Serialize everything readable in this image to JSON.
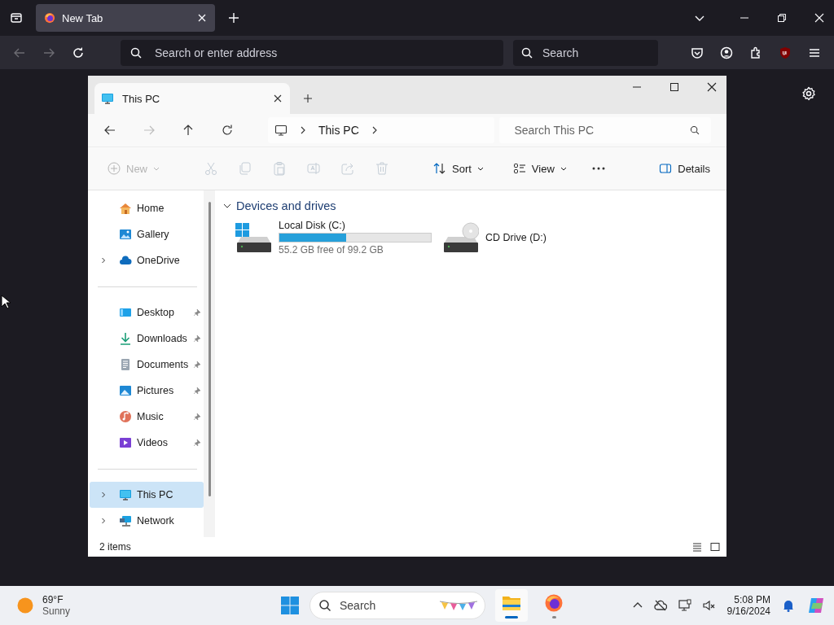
{
  "browser": {
    "tabs": [
      {
        "title": "New Tab",
        "selected": true
      }
    ],
    "address_placeholder": "Search or enter address",
    "search_placeholder": "Search",
    "back_disabled": true,
    "forward_disabled": true
  },
  "explorer": {
    "tabs": [
      {
        "title": "This PC",
        "selected": true
      }
    ],
    "forward_disabled": true,
    "breadcrumb": [
      "This PC"
    ],
    "search_placeholder": "Search This PC",
    "toolbar": {
      "new": {
        "label": "New",
        "disabled": true
      },
      "cut": {
        "disabled": true
      },
      "copy": {
        "disabled": true
      },
      "paste": {
        "disabled": true
      },
      "rename": {
        "disabled": true
      },
      "share": {
        "disabled": true
      },
      "delete": {
        "disabled": true
      },
      "sort": {
        "label": "Sort",
        "disabled": false
      },
      "view": {
        "label": "View",
        "disabled": false
      },
      "details": {
        "label": "Details"
      }
    },
    "sidebar": {
      "groups": [
        [
          {
            "label": "Home",
            "kind": "home",
            "collapsed": false,
            "pinned": false,
            "selected": false
          },
          {
            "label": "Gallery",
            "kind": "gallery",
            "collapsed": false,
            "pinned": false,
            "selected": false
          },
          {
            "label": "OneDrive",
            "kind": "cloud",
            "collapsed": true,
            "pinned": false,
            "selected": false
          }
        ],
        [
          {
            "label": "Desktop",
            "kind": "desktop",
            "collapsed": false,
            "pinned": true,
            "selected": false
          },
          {
            "label": "Downloads",
            "kind": "downloads",
            "collapsed": false,
            "pinned": true,
            "selected": false
          },
          {
            "label": "Documents",
            "kind": "documents",
            "collapsed": false,
            "pinned": true,
            "selected": false
          },
          {
            "label": "Pictures",
            "kind": "pictures",
            "collapsed": false,
            "pinned": true,
            "selected": false
          },
          {
            "label": "Music",
            "kind": "music",
            "collapsed": false,
            "pinned": true,
            "selected": false
          },
          {
            "label": "Videos",
            "kind": "videos",
            "collapsed": false,
            "pinned": true,
            "selected": false
          }
        ],
        [
          {
            "label": "This PC",
            "kind": "pc",
            "collapsed": true,
            "pinned": false,
            "selected": true
          },
          {
            "label": "Network",
            "kind": "network",
            "collapsed": true,
            "pinned": false,
            "selected": false
          }
        ]
      ]
    },
    "section": {
      "title": "Devices and drives",
      "expanded": true
    },
    "drives": [
      {
        "kind": "disk",
        "name": "Local Disk (C:)",
        "level": 0.44,
        "free": "55.2 GB free of 99.2 GB"
      },
      {
        "kind": "cd",
        "name": "CD Drive (D:)"
      }
    ],
    "status": "2 items"
  },
  "taskbar": {
    "weather": {
      "temperature": "69°F",
      "condition": "Sunny"
    },
    "search_placeholder": "Search",
    "apps": [
      {
        "kind": "explorer",
        "active": true
      },
      {
        "kind": "firefox",
        "active": false
      }
    ],
    "time": "5:08 PM",
    "date": "9/16/2024"
  }
}
